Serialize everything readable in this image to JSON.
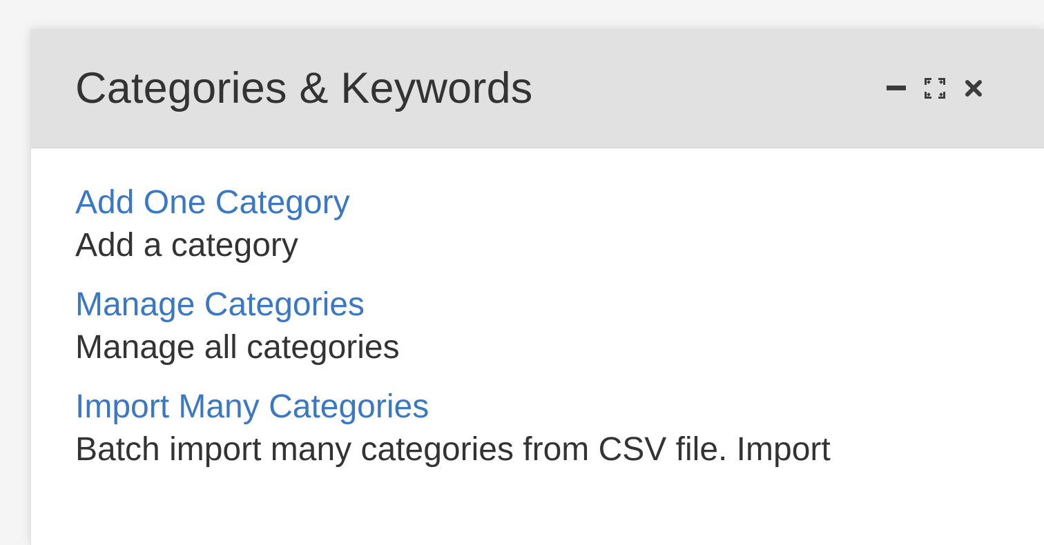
{
  "widget": {
    "title": "Categories & Keywords",
    "controls": [
      {
        "name": "minimize-icon",
        "icon": "minus"
      },
      {
        "name": "expand-icon",
        "icon": "expand-arrows"
      },
      {
        "name": "close-icon",
        "icon": "times"
      }
    ],
    "items": [
      {
        "link": "Add One Category",
        "description": "Add a category"
      },
      {
        "link": "Manage Categories",
        "description": "Manage all categories"
      },
      {
        "link": "Import Many Categories",
        "description": "Batch import many categories from CSV file. Import"
      }
    ]
  },
  "colors": {
    "header_bg": "#e1e1e1",
    "link": "#3a77c4",
    "text": "#333333"
  }
}
